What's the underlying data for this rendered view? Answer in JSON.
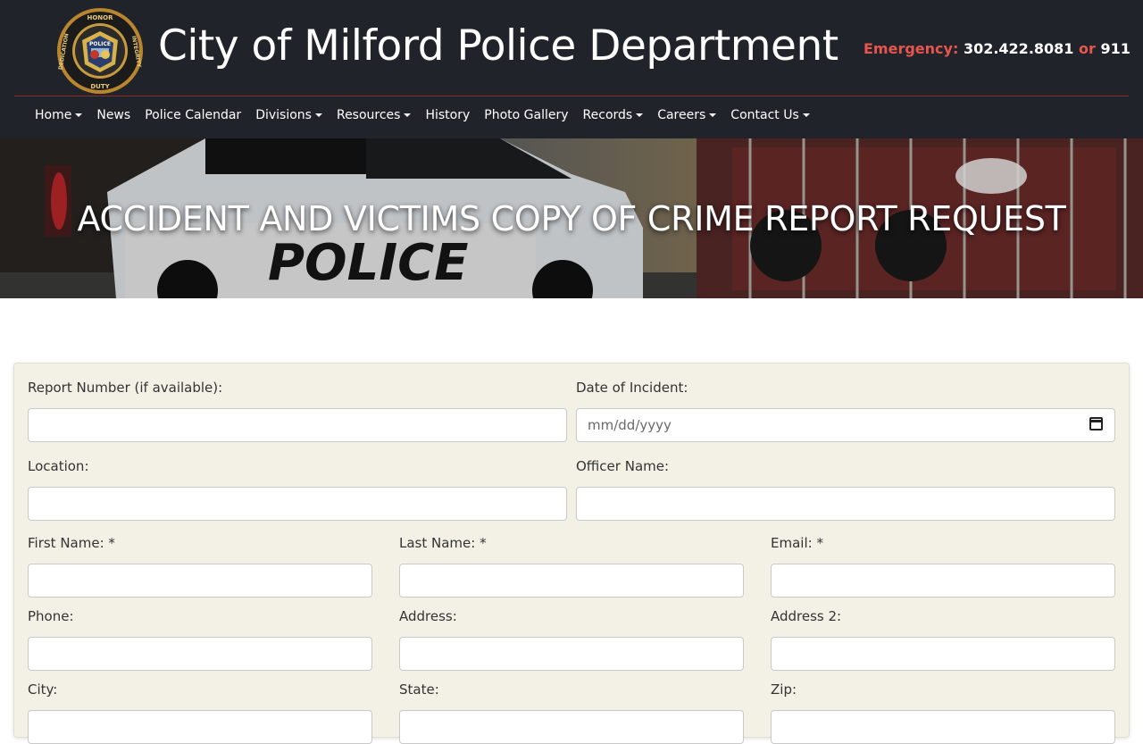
{
  "site": {
    "title": "City of Milford Police Department",
    "emergency_label": "Emergency:",
    "emergency_number": "302.422.8081",
    "emergency_or": "or",
    "emergency_911": "911",
    "badge": {
      "top_text": "HONOR",
      "left_text": "DEDICATION",
      "right_text": "INTEGRITY",
      "bottom_text": "DUTY",
      "center_text": "POLICE"
    }
  },
  "nav": {
    "items": [
      {
        "label": "Home",
        "dropdown": true
      },
      {
        "label": "News",
        "dropdown": false
      },
      {
        "label": "Police Calendar",
        "dropdown": false
      },
      {
        "label": "Divisions",
        "dropdown": true
      },
      {
        "label": "Resources",
        "dropdown": true
      },
      {
        "label": "History",
        "dropdown": false
      },
      {
        "label": "Photo Gallery",
        "dropdown": false
      },
      {
        "label": "Records",
        "dropdown": true
      },
      {
        "label": "Careers",
        "dropdown": true
      },
      {
        "label": "Contact Us",
        "dropdown": true
      }
    ]
  },
  "hero": {
    "title": "ACCIDENT AND VICTIMS COPY OF CRIME REPORT REQUEST",
    "car_text": "POLICE"
  },
  "form": {
    "report_number": {
      "label": "Report Number (if available):",
      "value": ""
    },
    "date_of_incident": {
      "label": "Date of Incident:",
      "placeholder": "mm/dd/yyyy",
      "value": ""
    },
    "location": {
      "label": "Location:",
      "value": ""
    },
    "officer_name": {
      "label": "Officer Name:",
      "value": ""
    },
    "first_name": {
      "label": "First Name: *",
      "value": ""
    },
    "last_name": {
      "label": "Last Name: *",
      "value": ""
    },
    "email": {
      "label": "Email: *",
      "value": ""
    },
    "phone": {
      "label": "Phone:",
      "value": ""
    },
    "address": {
      "label": "Address:",
      "value": ""
    },
    "address2": {
      "label": "Address 2:",
      "value": ""
    },
    "city": {
      "label": "City:",
      "value": ""
    },
    "state": {
      "label": "State:",
      "value": ""
    },
    "zip": {
      "label": "Zip:",
      "value": ""
    }
  },
  "colors": {
    "header_bg": "#20232a",
    "emergency_accent": "#e8554e",
    "form_bg": "#f3f1e6"
  }
}
